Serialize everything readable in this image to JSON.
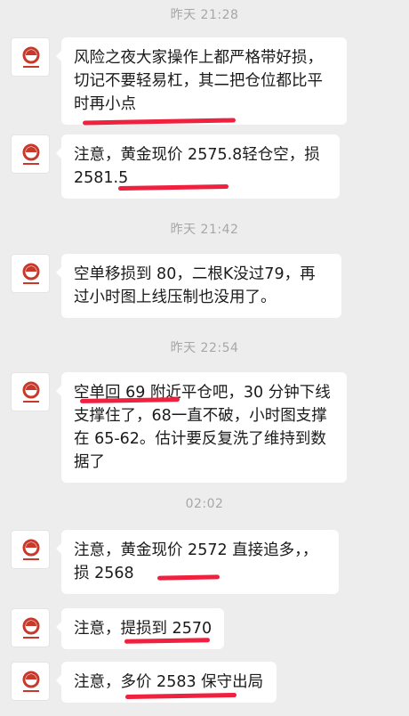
{
  "chat": {
    "messages": [
      {
        "time": "昨天 21:28",
        "text": "风险之夜大家操作上都严格带好损，切记不要轻易杠，其二把仓位都比平时再小点"
      },
      {
        "text": "注意，黄金现价 2575.8轻仓空，损 2581.5"
      },
      {
        "time": "昨天 21:42",
        "text": "空单移损到 80，二根K没过79，再过小时图上线压制也没用了。"
      },
      {
        "time": "昨天 22:54",
        "text": "空单回 69 附近平仓吧，30 分钟下线支撑住了，68一直不破，小时图支撑在 65-62。估计要反复洗了维持到数据了"
      },
      {
        "time": "02:02",
        "text": "注意，黄金现价 2572 直接追多，，损 2568"
      },
      {
        "text": "注意，提损到 2570"
      },
      {
        "text": "注意，多价 2583 保守出局"
      }
    ]
  },
  "avatar": {
    "icon": "brand-logo-icon",
    "accent": "#c8392b"
  },
  "colors": {
    "background": "#ededed",
    "bubble": "#ffffff",
    "timestamp": "#a7a7a7",
    "annotation": "#f0213f"
  }
}
